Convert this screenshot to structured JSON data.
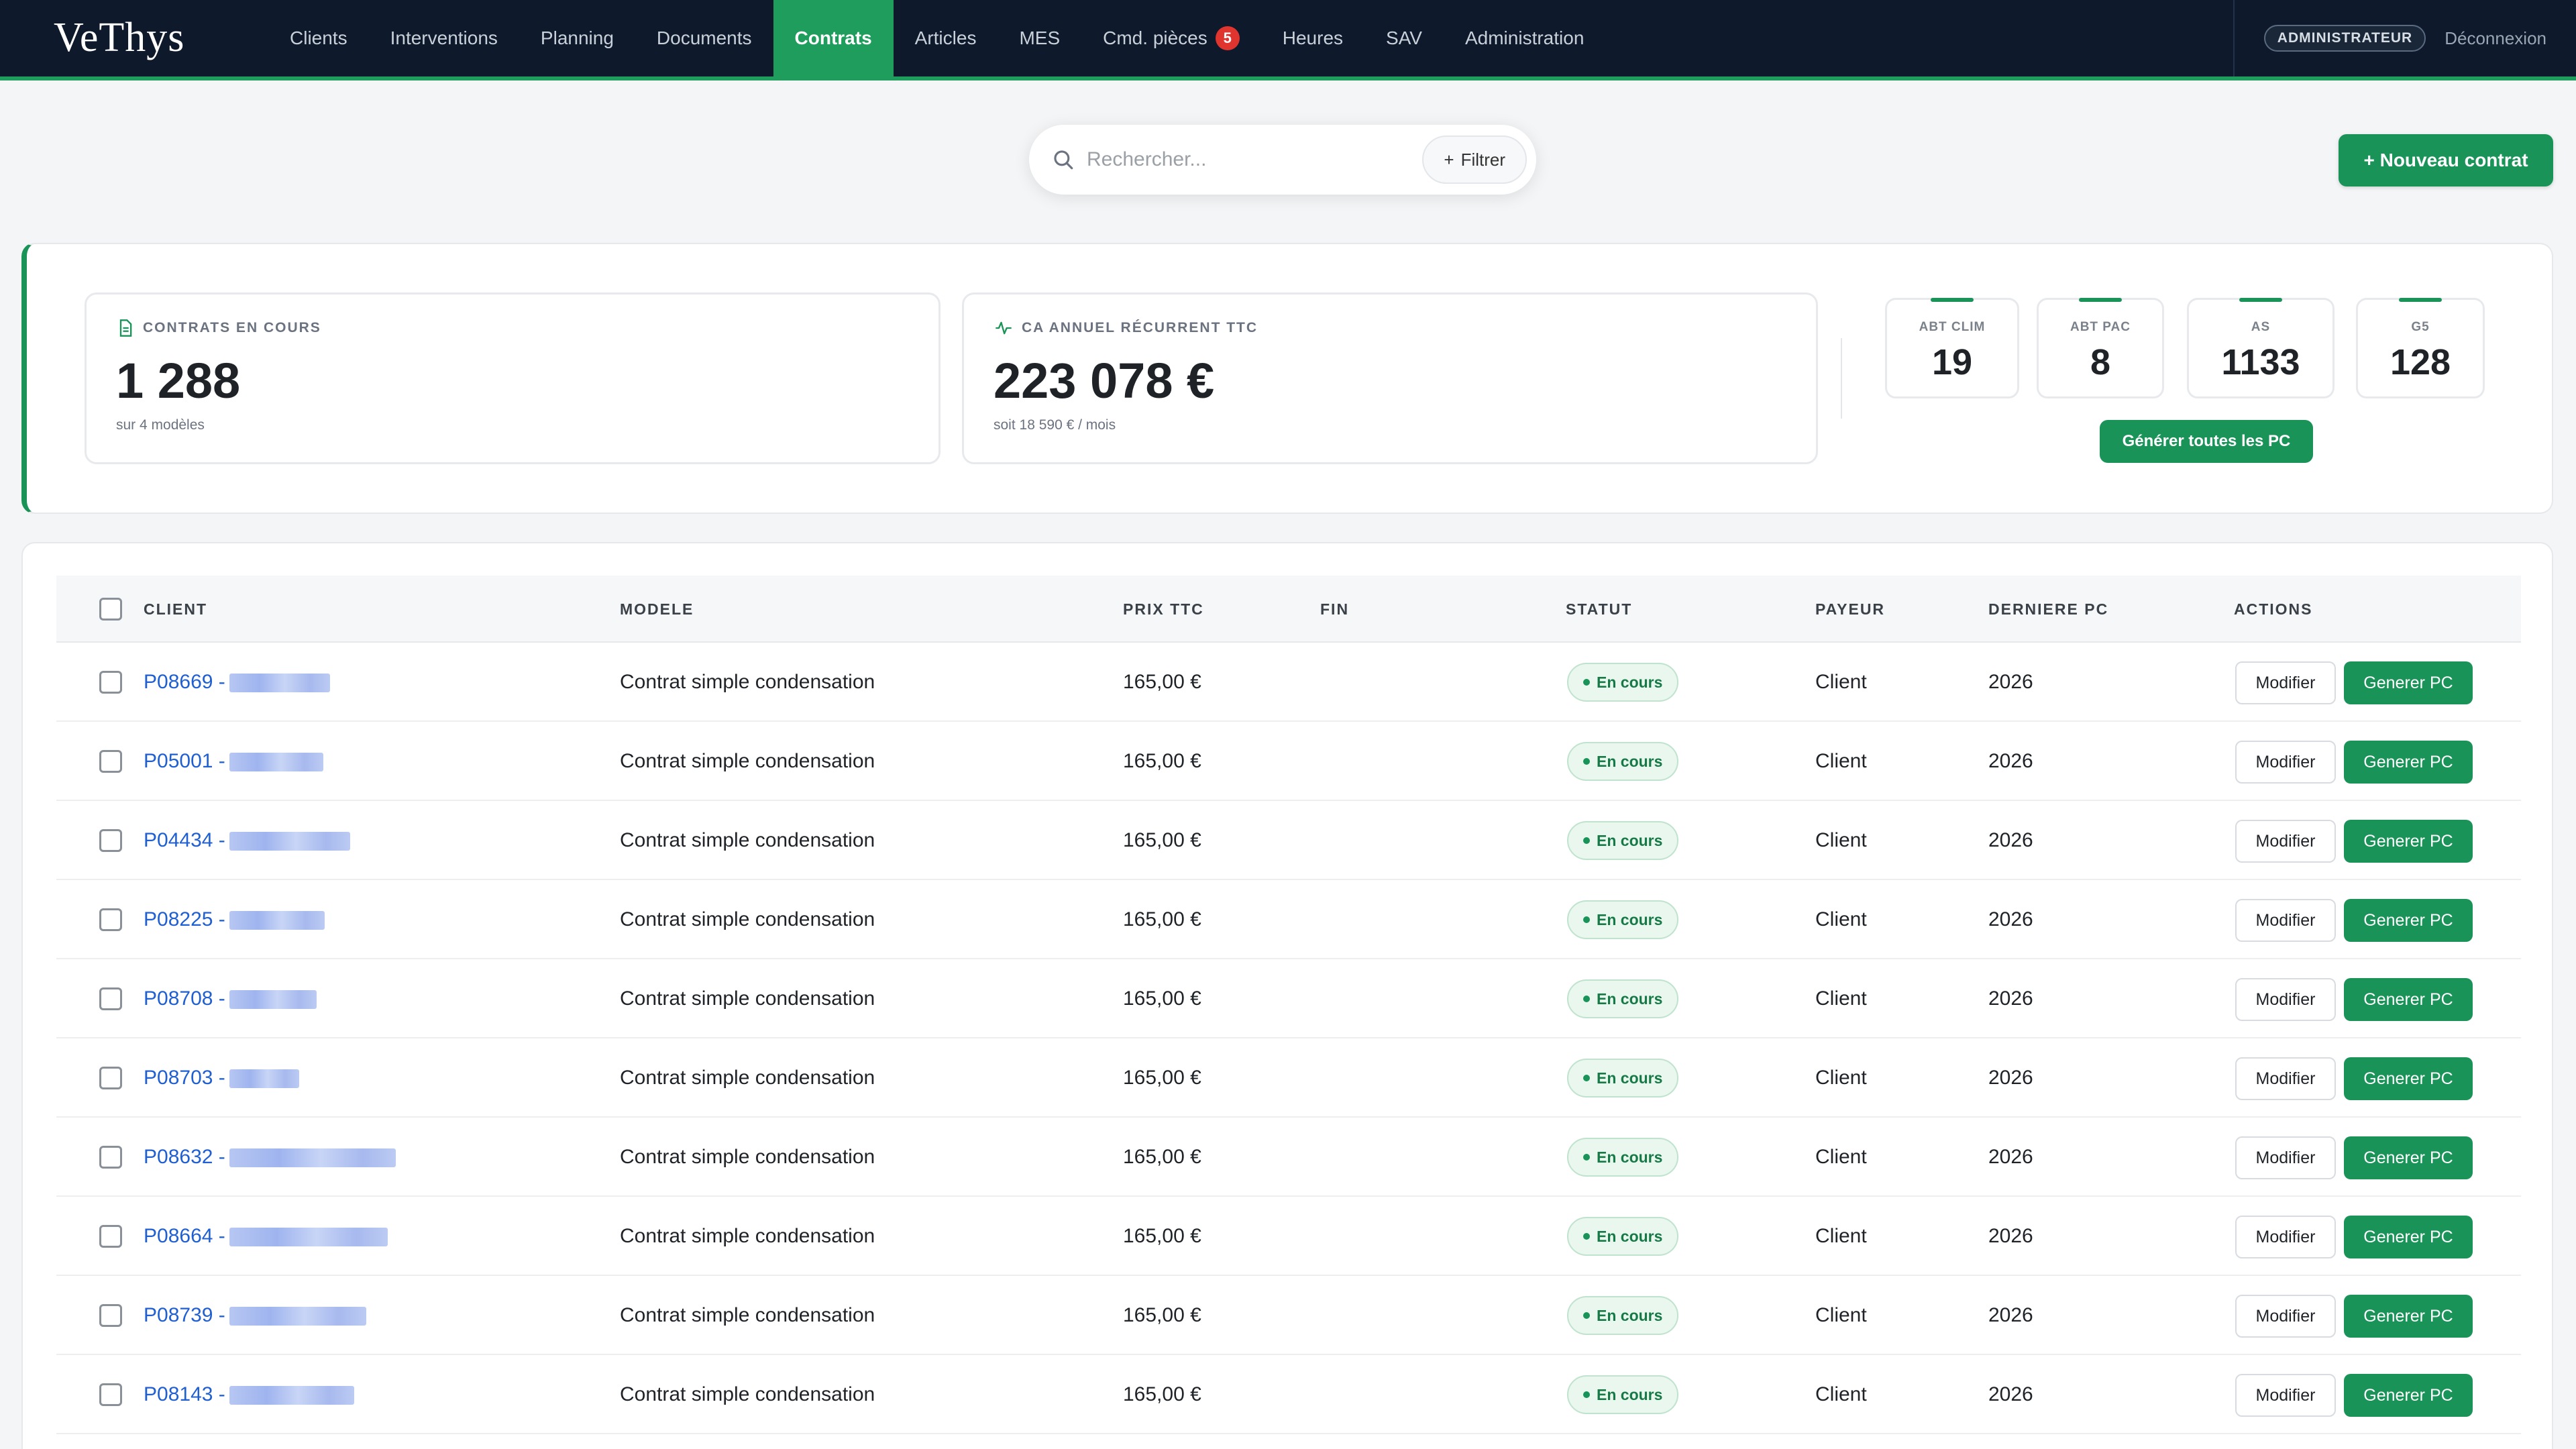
{
  "app": {
    "logo": "VeThys"
  },
  "nav": {
    "items": [
      {
        "label": "Clients"
      },
      {
        "label": "Interventions"
      },
      {
        "label": "Planning"
      },
      {
        "label": "Documents"
      },
      {
        "label": "Contrats",
        "active": true
      },
      {
        "label": "Articles"
      },
      {
        "label": "MES"
      },
      {
        "label": "Cmd. pièces",
        "badge": "5"
      },
      {
        "label": "Heures"
      },
      {
        "label": "SAV"
      },
      {
        "label": "Administration"
      }
    ],
    "role": "ADMINISTRATEUR",
    "logout": "Déconnexion"
  },
  "search": {
    "placeholder": "Rechercher...",
    "filter_label": "Filtrer"
  },
  "new_contract_label": "+ Nouveau contrat",
  "stats": {
    "contracts": {
      "label": "CONTRATS EN COURS",
      "value": "1 288",
      "sub": "sur 4 modèles"
    },
    "revenue": {
      "label": "CA ANNUEL RÉCURRENT TTC",
      "value": "223 078 €",
      "sub": "soit 18 590 € / mois"
    },
    "models": [
      {
        "label": "ABT CLIM",
        "value": "19"
      },
      {
        "label": "ABT PAC",
        "value": "8"
      },
      {
        "label": "AS",
        "value": "1133"
      },
      {
        "label": "G5",
        "value": "128"
      }
    ],
    "generate_all_label": "Générer toutes les PC"
  },
  "table": {
    "columns": [
      "CLIENT",
      "MODELE",
      "PRIX TTC",
      "FIN",
      "STATUT",
      "PAYEUR",
      "DERNIERE PC",
      "ACTIONS"
    ],
    "modify_label": "Modifier",
    "generate_label": "Generer PC",
    "rows": [
      {
        "client": "P08669 -",
        "modele": "Contrat simple condensation",
        "prix": "165,00 €",
        "fin": "",
        "statut": "En cours",
        "payeur": "Client",
        "derniere_pc": "2026"
      },
      {
        "client": "P05001 -",
        "modele": "Contrat simple condensation",
        "prix": "165,00 €",
        "fin": "",
        "statut": "En cours",
        "payeur": "Client",
        "derniere_pc": "2026"
      },
      {
        "client": "P04434 -",
        "modele": "Contrat simple condensation",
        "prix": "165,00 €",
        "fin": "",
        "statut": "En cours",
        "payeur": "Client",
        "derniere_pc": "2026"
      },
      {
        "client": "P08225 -",
        "modele": "Contrat simple condensation",
        "prix": "165,00 €",
        "fin": "",
        "statut": "En cours",
        "payeur": "Client",
        "derniere_pc": "2026"
      },
      {
        "client": "P08708 -",
        "modele": "Contrat simple condensation",
        "prix": "165,00 €",
        "fin": "",
        "statut": "En cours",
        "payeur": "Client",
        "derniere_pc": "2026"
      },
      {
        "client": "P08703 -",
        "modele": "Contrat simple condensation",
        "prix": "165,00 €",
        "fin": "",
        "statut": "En cours",
        "payeur": "Client",
        "derniere_pc": "2026"
      },
      {
        "client": "P08632 -",
        "modele": "Contrat simple condensation",
        "prix": "165,00 €",
        "fin": "",
        "statut": "En cours",
        "payeur": "Client",
        "derniere_pc": "2026"
      },
      {
        "client": "P08664 -",
        "modele": "Contrat simple condensation",
        "prix": "165,00 €",
        "fin": "",
        "statut": "En cours",
        "payeur": "Client",
        "derniere_pc": "2026"
      },
      {
        "client": "P08739 -",
        "modele": "Contrat simple condensation",
        "prix": "165,00 €",
        "fin": "",
        "statut": "En cours",
        "payeur": "Client",
        "derniere_pc": "2026"
      },
      {
        "client": "P08143 -",
        "modele": "Contrat simple condensation",
        "prix": "165,00 €",
        "fin": "",
        "statut": "En cours",
        "payeur": "Client",
        "derniere_pc": "2026"
      }
    ]
  },
  "colors": {
    "brand_green": "#1a9358",
    "nav_bg": "#0e1a2b",
    "link_blue": "#1f5fd1",
    "badge_red": "#e0342f"
  }
}
